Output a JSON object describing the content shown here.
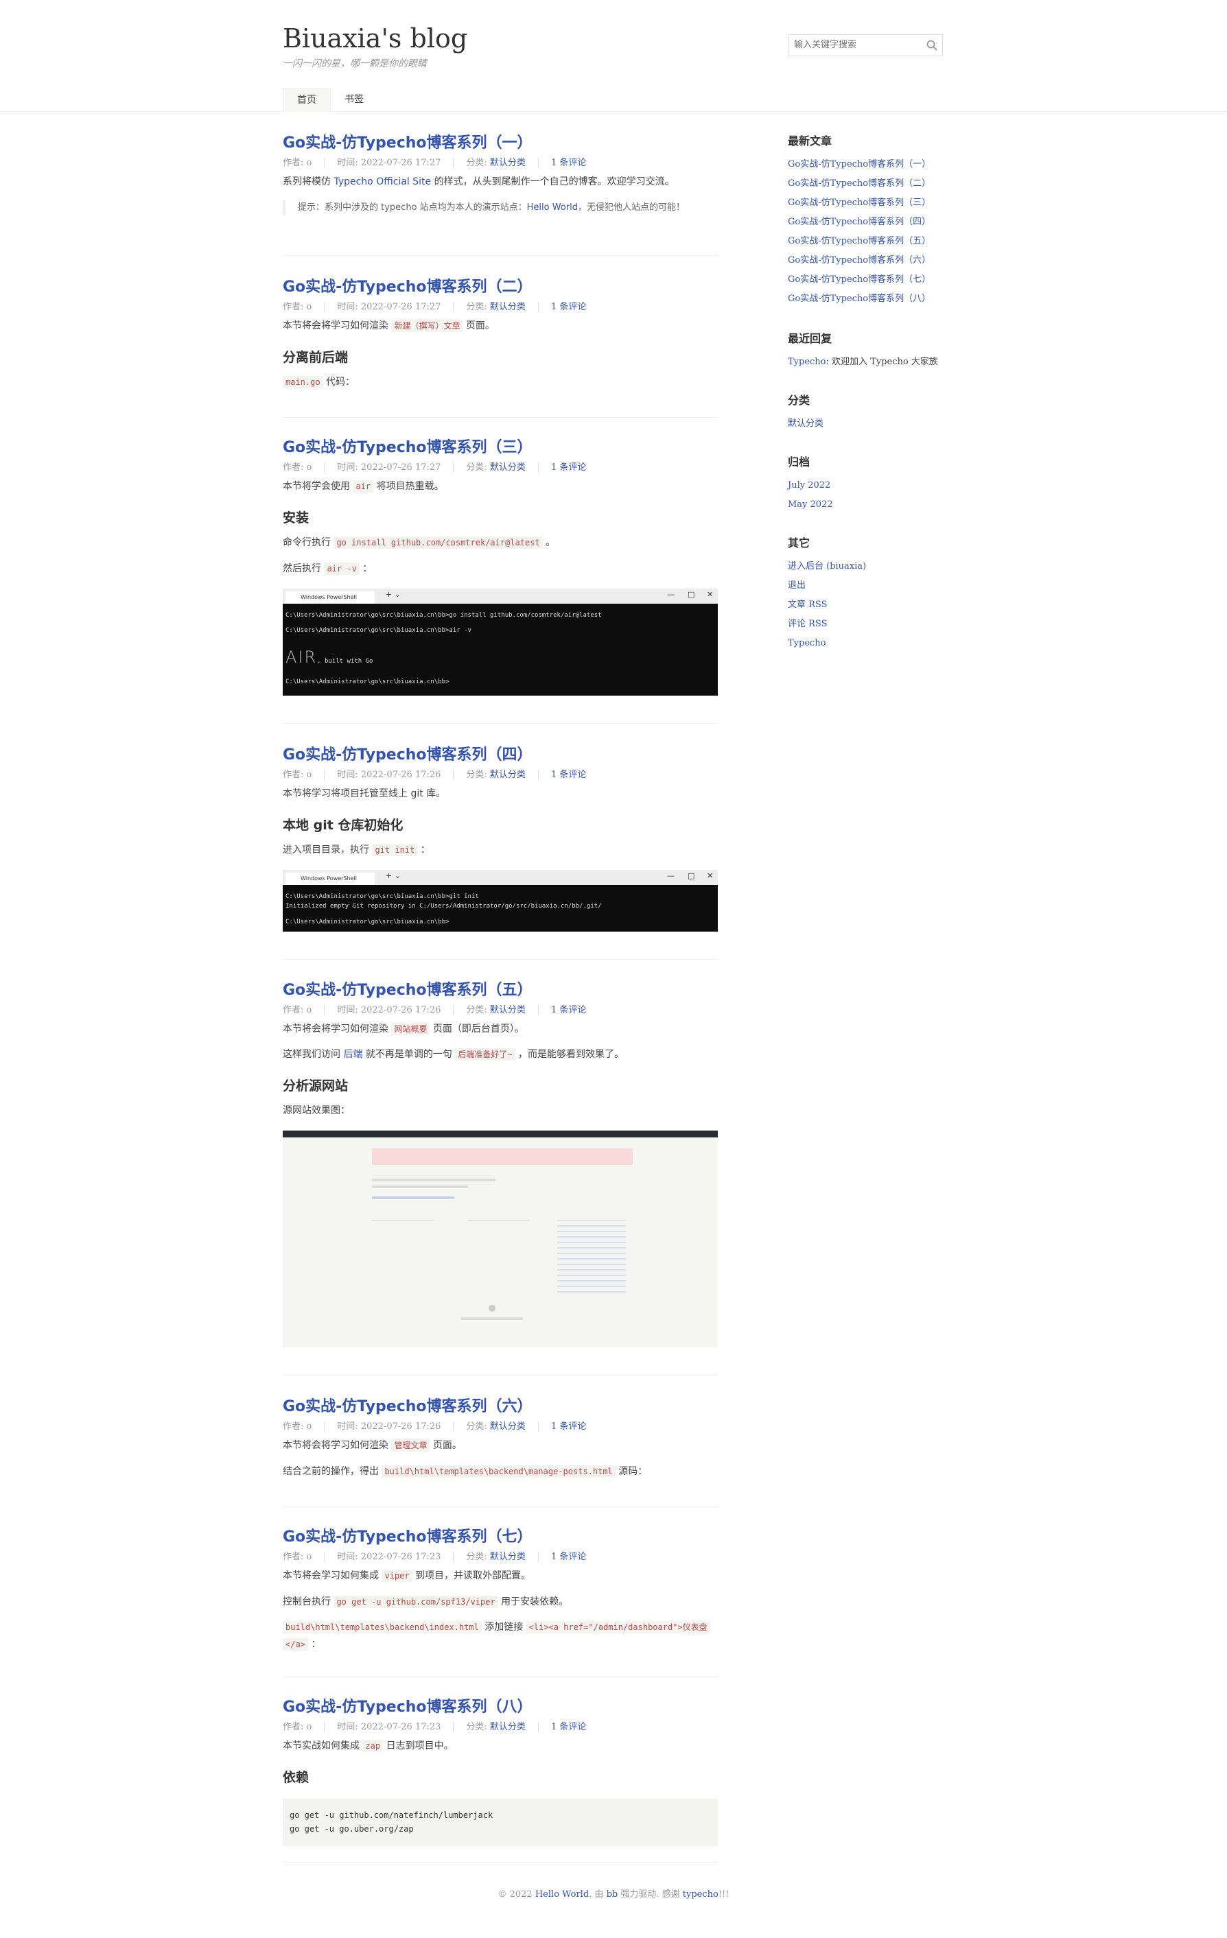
{
  "site": {
    "title": "Biuaxia's blog",
    "description": "一闪一闪的星，哪一颗是你的眼睛"
  },
  "search": {
    "placeholder": "输入关键字搜索"
  },
  "nav": {
    "home": "首页",
    "bookmark": "书签"
  },
  "posts": [
    {
      "title": "Go实战-仿Typecho博客系列（一）",
      "author": "作者: o",
      "time": "时间: 2022-07-26 17:27",
      "category_label": "分类: ",
      "category": "默认分类",
      "comments": "1 条评论"
    },
    {
      "title": "Go实战-仿Typecho博客系列（二）",
      "author": "作者: o",
      "time": "时间: 2022-07-26 17:27",
      "category_label": "分类: ",
      "category": "默认分类",
      "comments": "1 条评论"
    },
    {
      "title": "Go实战-仿Typecho博客系列（三）",
      "author": "作者: o",
      "time": "时间: 2022-07-26 17:27",
      "category_label": "分类: ",
      "category": "默认分类",
      "comments": "1 条评论"
    },
    {
      "title": "Go实战-仿Typecho博客系列（四）",
      "author": "作者: o",
      "time": "时间: 2022-07-26 17:26",
      "category_label": "分类: ",
      "category": "默认分类",
      "comments": "1 条评论"
    },
    {
      "title": "Go实战-仿Typecho博客系列（五）",
      "author": "作者: o",
      "time": "时间: 2022-07-26 17:26",
      "category_label": "分类: ",
      "category": "默认分类",
      "comments": "1 条评论"
    },
    {
      "title": "Go实战-仿Typecho博客系列（六）",
      "author": "作者: o",
      "time": "时间: 2022-07-26 17:26",
      "category_label": "分类: ",
      "category": "默认分类",
      "comments": "1 条评论"
    },
    {
      "title": "Go实战-仿Typecho博客系列（七）",
      "author": "作者: o",
      "time": "时间: 2022-07-26 17:23",
      "category_label": "分类: ",
      "category": "默认分类",
      "comments": "1 条评论"
    },
    {
      "title": "Go实战-仿Typecho博客系列（八）",
      "author": "作者: o",
      "time": "时间: 2022-07-26 17:23",
      "category_label": "分类: ",
      "category": "默认分类",
      "comments": "1 条评论"
    }
  ],
  "p1": {
    "t1": "系列将模仿 ",
    "link": "Typecho Official Site",
    "t2": " 的样式，从头到尾制作一个自己的博客。欢迎学习交流。",
    "q1": "提示：系列中涉及的 typecho 站点均为本人的演示站点：",
    "qlink": "Hello World",
    "q2": "，无侵犯他人站点的可能！"
  },
  "p2": {
    "t1": "本节将会将学习如何渲染 ",
    "code": "新建（撰写）文章",
    "t2": " 页面。",
    "h": "分离前后端",
    "code2": "main.go",
    "t3": " 代码："
  },
  "p3": {
    "t1": "本节将学会使用 ",
    "code": "air",
    "t2": " 将项目热重载。",
    "h": "安装",
    "t3": "命令行执行 ",
    "code2": "go install github.com/cosmtrek/air@latest",
    "t4": " 。",
    "t5": "然后执行 ",
    "code3": "air -v",
    "t6": " ：",
    "term": {
      "tab": "Windows PowerShell",
      "l1": "C:\\Users\\Administrator\\go\\src\\biuaxia.cn\\bb>go install github.com/cosmtrek/air@latest",
      "l2": "C:\\Users\\Administrator\\go\\src\\biuaxia.cn\\bb>air -v",
      "logo": "AIR",
      "built": ", built with Go",
      "l3": "C:\\Users\\Administrator\\go\\src\\biuaxia.cn\\bb>"
    }
  },
  "p4": {
    "t1": "本节将学习将项目托管至线上 git 库。",
    "h": "本地 git 仓库初始化",
    "t2": "进入项目目录，执行 ",
    "code": "git init",
    "t3": " ：",
    "term": {
      "tab": "Windows PowerShell",
      "l1": "C:\\Users\\Administrator\\go\\src\\biuaxia.cn\\bb>git init",
      "l2": "Initialized empty Git repository in C:/Users/Administrator/go/src/biuaxia.cn/bb/.git/",
      "l3": "C:\\Users\\Administrator\\go\\src\\biuaxia.cn\\bb>"
    }
  },
  "p5": {
    "t1": "本节将会将学习如何渲染 ",
    "code": "网站概要",
    "t2": " 页面（即后台首页）。",
    "t3": "这样我们访问 ",
    "link": "后端",
    "t4": " 就不再是单调的一句 ",
    "code2": "后端准备好了~",
    "t5": " ，而是能够看到效果了。",
    "h": "分析源网站",
    "t6": "源网站效果图："
  },
  "p6": {
    "t1": "本节将会将学习如何渲染 ",
    "code": "管理文章",
    "t2": " 页面。",
    "t3": "结合之前的操作，得出 ",
    "code2": "build\\html\\templates\\backend\\manage-posts.html",
    "t4": " 源码："
  },
  "p7": {
    "t1": "本节将会学习如何集成 ",
    "code": "viper",
    "t2": " 到项目，并读取外部配置。",
    "t3": "控制台执行 ",
    "code2": "go get -u github.com/spf13/viper",
    "t4": " 用于安装依赖。",
    "code3": "build\\html\\templates\\backend\\index.html",
    "t5": " 添加链接 ",
    "code4": "<li><a href=\"/admin/dashboard\">仪表盘",
    "code5": "</a>",
    "t6": " ："
  },
  "p8": {
    "t1": "本节实战如何集成 ",
    "code": "zap",
    "t2": " 日志到项目中。",
    "h": "依赖",
    "pre1": "go get -u github.com/natefinch/lumberjack",
    "pre2": "go get -u go.uber.org/zap"
  },
  "sidebar": {
    "recent_title": "最新文章",
    "recent": [
      "Go实战-仿Typecho博客系列（一）",
      "Go实战-仿Typecho博客系列（二）",
      "Go实战-仿Typecho博客系列（三）",
      "Go实战-仿Typecho博客系列（四）",
      "Go实战-仿Typecho博客系列（五）",
      "Go实战-仿Typecho博客系列（六）",
      "Go实战-仿Typecho博客系列（七）",
      "Go实战-仿Typecho博客系列（八）"
    ],
    "reply_title": "最近回复",
    "reply_author": "Typecho",
    "reply_text": ": 欢迎加入 Typecho 大家族",
    "cat_title": "分类",
    "cat": "默认分类",
    "archive_title": "归档",
    "archives": [
      "July 2022",
      "May 2022"
    ],
    "other_title": "其它",
    "others": [
      "进入后台 (biuaxia)",
      "退出",
      "文章 RSS",
      "评论 RSS",
      "Typecho"
    ]
  },
  "footer": {
    "c": "© 2022 ",
    "site": "Hello World",
    "t1": ". 由 ",
    "bb": "bb",
    "t2": " 强力驱动. 感谢 ",
    "typecho": "typecho",
    "t3": "!!!"
  },
  "colors": {
    "link": "#3354AA",
    "code": "#B94A48",
    "code_bg": "#F3F3F0"
  }
}
